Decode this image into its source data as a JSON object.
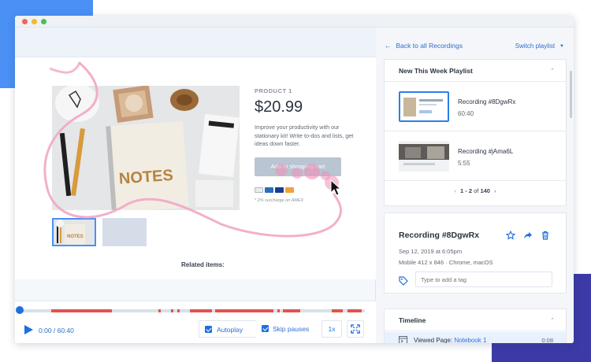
{
  "colors": {
    "accent": "#1f6fe0",
    "link": "#2f6fd0",
    "event_segment": "#e5524d",
    "deco_blue": "#4a90f5",
    "deco_purple": "#3b3aa6",
    "trail": "#f2a6c4"
  },
  "product": {
    "label": "PRODUCT 1",
    "price": "$20.99",
    "description": "Improve your productivity with our stationary kit! Write to-dos and lists, get ideas down faster.",
    "button": "Add to shopping cart",
    "note": "* 2% surcharge on AMEX",
    "image_text": "NOTES",
    "thumb_text": "NOTES",
    "related": "Related items:"
  },
  "player": {
    "time": "0:00 / 60:40",
    "autoplay": "Autoplay",
    "skip_pauses": "Skip pauses",
    "speed": "1x",
    "autoplay_checked": true,
    "skip_pauses_checked": true,
    "progress": 0
  },
  "sidebar": {
    "back": "Back to all Recordings",
    "switch": "Switch playlist",
    "playlist_title": "New This Week Playlist",
    "recordings": [
      {
        "name": "Recording #8DgwRx",
        "duration": "60:40"
      },
      {
        "name": "Recording #jAma6L",
        "duration": "5:55"
      }
    ],
    "pager": {
      "range": "1 - 2",
      "of": "of",
      "total": "140"
    },
    "detail": {
      "title": "Recording #8DgwRx",
      "date": "Sep 12, 2019 at 6:05pm",
      "device": "Mobile 412 x 846  ·  Chrome, macOS",
      "tag_placeholder": "Type to add a tag"
    },
    "timeline": {
      "title": "Timeline",
      "event_label": "Viewed Page:",
      "event_link": "Notebook 1",
      "event_time": "0:08"
    }
  }
}
